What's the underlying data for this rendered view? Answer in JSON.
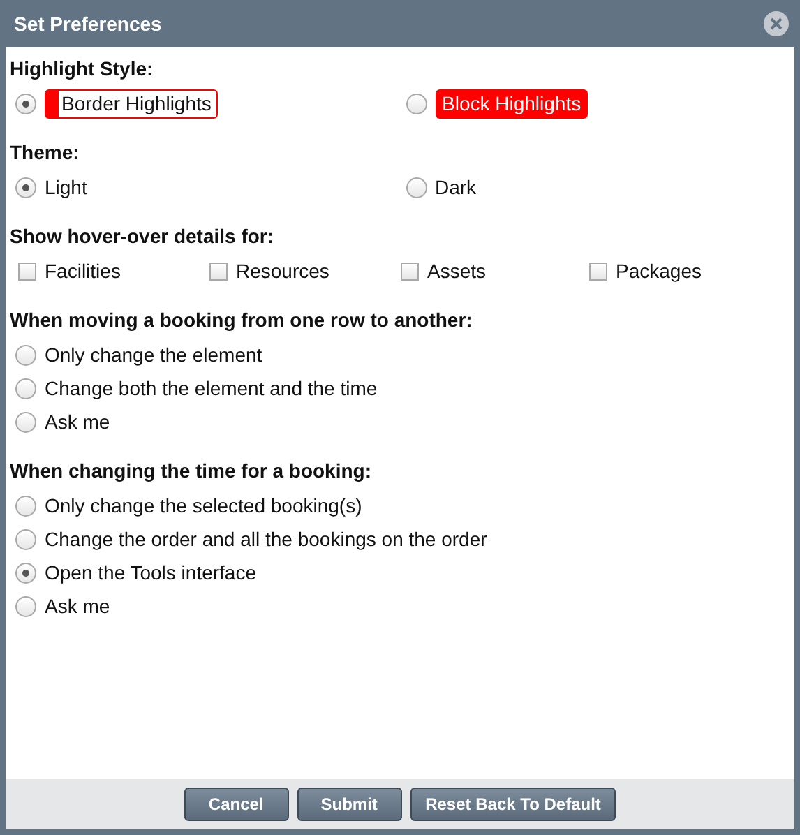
{
  "window": {
    "title": "Set Preferences"
  },
  "sections": [
    {
      "heading": "Highlight Style:",
      "kind": "radio_columns",
      "options": [
        {
          "label": "Border Highlights",
          "selected": true,
          "kind": "border"
        },
        {
          "label": "Block Highlights",
          "selected": false,
          "kind": "block"
        }
      ]
    },
    {
      "heading": "Theme:",
      "kind": "radio_columns",
      "options": [
        {
          "label": "Light",
          "selected": true
        },
        {
          "label": "Dark",
          "selected": false
        }
      ]
    },
    {
      "heading": "Show hover-over details for:",
      "kind": "checkbox_columns",
      "options": [
        {
          "label": "Facilities",
          "checked": false
        },
        {
          "label": "Resources",
          "checked": false
        },
        {
          "label": "Assets",
          "checked": false
        },
        {
          "label": "Packages",
          "checked": false
        }
      ]
    },
    {
      "heading": "When moving a booking from one row to another:",
      "kind": "radio_list",
      "options": [
        {
          "label": "Only change the element",
          "selected": false
        },
        {
          "label": "Change both the element and the time",
          "selected": false
        },
        {
          "label": "Ask me",
          "selected": false
        }
      ]
    },
    {
      "heading": "When changing the time for a booking:",
      "kind": "radio_list",
      "options": [
        {
          "label": "Only change the selected booking(s)",
          "selected": false
        },
        {
          "label": "Change the order and all the bookings on the order",
          "selected": false
        },
        {
          "label": "Open the Tools interface",
          "selected": true
        },
        {
          "label": "Ask me",
          "selected": false
        }
      ]
    }
  ],
  "buttons": [
    "Cancel",
    "Submit",
    "Reset Back To Default"
  ]
}
